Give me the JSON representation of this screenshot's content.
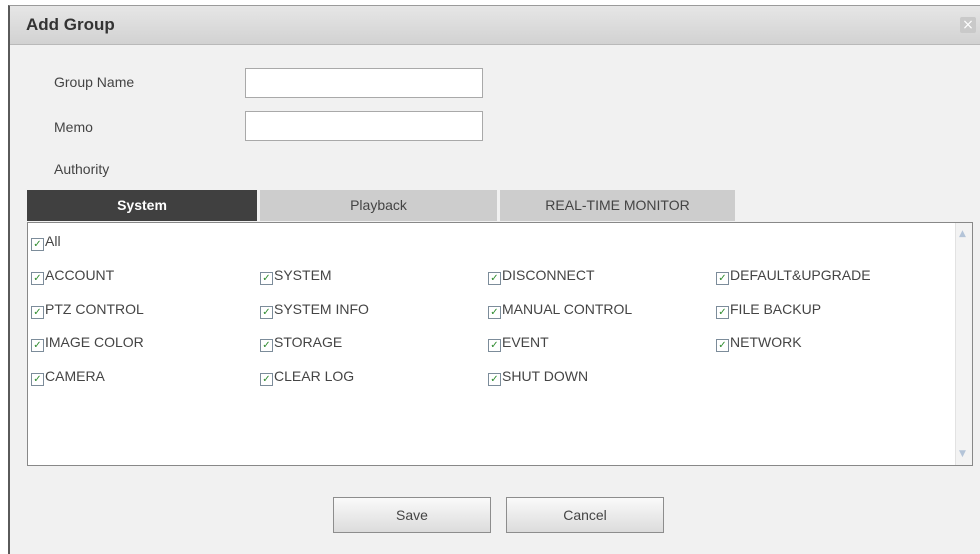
{
  "dialog": {
    "title": "Add Group",
    "close_icon": "×"
  },
  "form": {
    "group_name_label": "Group Name",
    "group_name_value": "",
    "memo_label": "Memo",
    "memo_value": "",
    "authority_label": "Authority"
  },
  "tabs": [
    {
      "label": "System",
      "active": true
    },
    {
      "label": "Playback",
      "active": false
    },
    {
      "label": "REAL-TIME MONITOR",
      "active": false
    }
  ],
  "permissions": {
    "all_label": "All",
    "items": [
      {
        "label": "ACCOUNT",
        "checked": true
      },
      {
        "label": "SYSTEM",
        "checked": true
      },
      {
        "label": "DISCONNECT",
        "checked": true
      },
      {
        "label": "DEFAULT&UPGRADE",
        "checked": true
      },
      {
        "label": "PTZ CONTROL",
        "checked": true
      },
      {
        "label": "SYSTEM INFO",
        "checked": true
      },
      {
        "label": "MANUAL CONTROL",
        "checked": true
      },
      {
        "label": "FILE BACKUP",
        "checked": true
      },
      {
        "label": "IMAGE COLOR",
        "checked": true
      },
      {
        "label": "STORAGE",
        "checked": true
      },
      {
        "label": "EVENT",
        "checked": true
      },
      {
        "label": "NETWORK",
        "checked": true
      },
      {
        "label": "CAMERA",
        "checked": true
      },
      {
        "label": "CLEAR LOG",
        "checked": true
      },
      {
        "label": "SHUT DOWN",
        "checked": true
      }
    ]
  },
  "buttons": {
    "save_label": "Save",
    "cancel_label": "Cancel"
  },
  "icons": {
    "checkbox": "checkmark-icon",
    "scroll_up": "chevron-up-icon",
    "scroll_down": "chevron-down-icon",
    "close": "close-icon"
  }
}
